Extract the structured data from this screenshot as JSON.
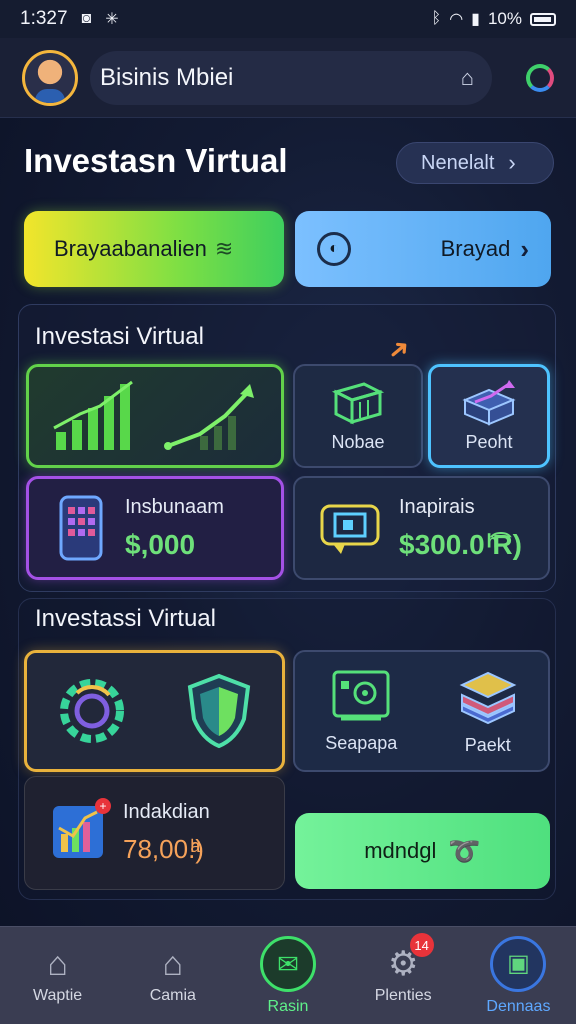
{
  "status_bar": {
    "time": "1:327",
    "battery": "10%"
  },
  "header": {
    "title": "Bisinis Mbiei"
  },
  "page": {
    "title": "Investasn Virtual",
    "next_label": "Nenelalt"
  },
  "actions": {
    "primary_label": "Brayaabanalien",
    "secondary_label": "Brayad"
  },
  "section1": {
    "title": "Investasi Virtual",
    "cards": {
      "box_label": "Nobae",
      "cube_label": "Peoht",
      "instrument_label": "Insbunaam",
      "instrument_amount": "$,000",
      "inspirasi_label": "Inapirais",
      "inspirasi_amount": "$300.0 ͪ͡R)"
    }
  },
  "section2": {
    "title": "Investassi Virtual",
    "cards": {
      "safe_label": "Seapapa",
      "packet_label": "Paekt",
      "indicator_label": "Indakdian",
      "indicator_amount": "78,00.ͪͣ)",
      "cta_label": "mdndgl"
    }
  },
  "bottom_nav": [
    {
      "label": "Waptie",
      "icon": "home-icon"
    },
    {
      "label": "Camia",
      "icon": "store-icon"
    },
    {
      "label": "Rasin",
      "icon": "chat-icon"
    },
    {
      "label": "Plenties",
      "icon": "gear-icon",
      "badge": "14"
    },
    {
      "label": "Dennaas",
      "icon": "wallet-icon"
    }
  ],
  "colors": {
    "accent_green": "#3ee06a",
    "accent_blue": "#4ec3ff",
    "accent_purple": "#a451e6",
    "accent_gold": "#e9b23c",
    "badge_red": "#e8333a"
  }
}
